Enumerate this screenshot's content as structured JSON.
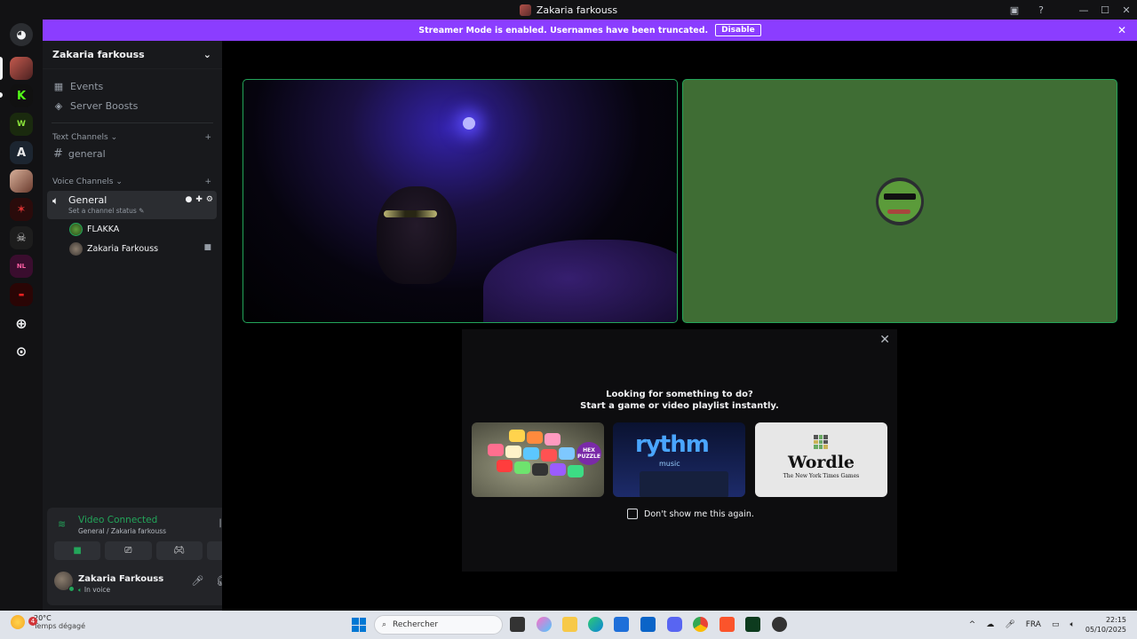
{
  "window": {
    "title": "Zakaria farkouss",
    "controls": [
      "—",
      "☐",
      "✕"
    ]
  },
  "banner": {
    "text": "Streamer Mode is enabled. Usernames have been truncated.",
    "disable_label": "Disable"
  },
  "server": {
    "name": "Zakaria farkouss",
    "nav": [
      {
        "label": "Events",
        "icon": "calendar-icon"
      },
      {
        "label": "Server Boosts",
        "icon": "boost-icon"
      }
    ],
    "text_category": "Text Channels",
    "text_channels": [
      {
        "name": "general"
      }
    ],
    "voice_category": "Voice Channels",
    "voice_channel": {
      "name": "General",
      "status": "Set a channel status"
    },
    "voice_users": [
      {
        "name": "FLAKKA",
        "avatar_color": "#4caf50"
      },
      {
        "name": "Zakaria Farkouss",
        "avatar_color": "#7a6f64",
        "camera": true
      }
    ]
  },
  "voice_panel": {
    "status": "Video Connected",
    "location": "General / Zakaria farkouss",
    "user_name": "Zakaria Farkouss",
    "user_status": "In voice"
  },
  "activity_modal": {
    "line1": "Looking for something to do?",
    "line2": "Start a game or video playlist instantly.",
    "cards": [
      {
        "label": "HEX PUZZLE",
        "type": "game"
      },
      {
        "label": "rythm",
        "sub": "music",
        "type": "music"
      },
      {
        "label": "Wordle",
        "sub": "The New York Times Games",
        "type": "game"
      }
    ],
    "checkbox_label": "Don't show me this again."
  },
  "taskbar": {
    "weather_temp": "20°C",
    "weather_desc": "Temps dégagé",
    "weather_badge": "4",
    "search_placeholder": "Rechercher",
    "language": "FRA",
    "time": "22:15",
    "date": "05/10/2025"
  },
  "colors": {
    "accent_banner": "#8b3dff",
    "voice_green": "#23a55a",
    "user_tile": "#3f6d34"
  }
}
